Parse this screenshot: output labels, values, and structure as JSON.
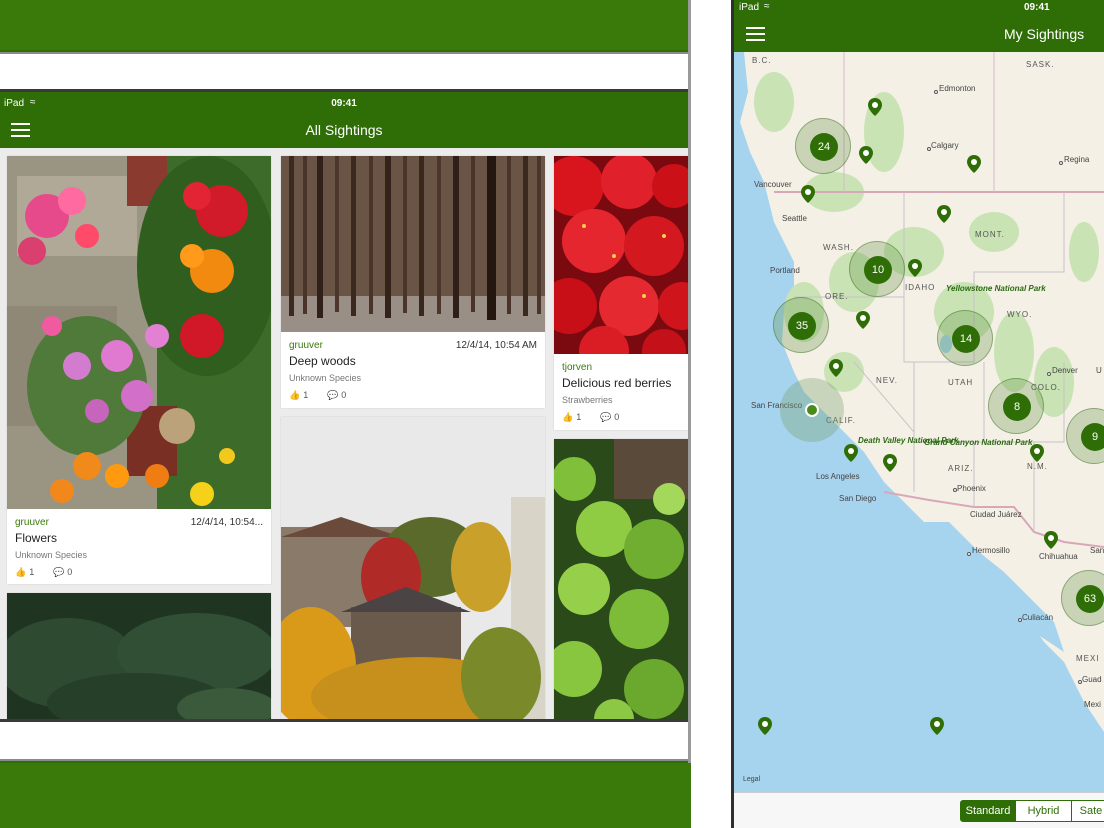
{
  "left": {
    "status": {
      "carrier": "iPad",
      "time": "09:41"
    },
    "nav": {
      "title": "All Sightings"
    },
    "cards": [
      {
        "user": "gruuver",
        "date": "12/4/14, 10:54...",
        "title": "Flowers",
        "species": "Unknown Species",
        "likes": "1",
        "comments": "0"
      },
      {
        "user": "gruuver",
        "date": "12/4/14, 10:54 AM",
        "title": "Deep woods",
        "species": "Unknown Species",
        "likes": "1",
        "comments": "0"
      },
      {
        "user": "tjorven",
        "date": "",
        "title": "Delicious red berries",
        "species": "Strawberries",
        "likes": "1",
        "comments": "0"
      }
    ]
  },
  "right": {
    "status": {
      "carrier": "iPad",
      "time": "09:41"
    },
    "nav": {
      "title": "My Sightings"
    },
    "map": {
      "legal": "Legal",
      "labels": {
        "bc": "B.C.",
        "sask": "SASK.",
        "edmonton": "Edmonton",
        "calgary": "Calgary",
        "regina": "Regina",
        "vancouver": "Vancouver",
        "seattle": "Seattle",
        "wash": "WASH.",
        "mont": "MONT.",
        "portland": "Portland",
        "idaho": "IDAHO",
        "ore": "ORE.",
        "wyo": "WYO.",
        "yellowstone": "Yellowstone National Park",
        "nev": "NEV.",
        "utah": "UTAH",
        "colo": "COLO.",
        "denver": "Denver",
        "sf": "San Francisco",
        "calif": "CALIF.",
        "deathvalley": "Death Valley National Park",
        "grandcanyon": "Grand Canyon National Park",
        "losangeles": "Los Angeles",
        "sandiego": "San Diego",
        "ariz": "ARIZ.",
        "phoenix": "Phoenix",
        "nm": "N.M.",
        "juarez": "Ciudad Juárez",
        "hermosillo": "Hermosillo",
        "chihuahua": "Chihuahua",
        "culiacan": "Culiacán",
        "mexi": "MEXI",
        "guad": "Guad",
        "mexi2": "Mexi",
        "san": "San",
        "u": "U"
      },
      "clusters": [
        "24",
        "10",
        "35",
        "14",
        "8",
        "9",
        "63"
      ]
    },
    "toolbar": {
      "standard": "Standard",
      "hybrid": "Hybrid",
      "satellite": "Sate"
    },
    "colors": {
      "accent": "#2f6e07",
      "water": "#a6d3ee",
      "land": "#f4f0e6",
      "park": "#c9e3b4"
    }
  }
}
